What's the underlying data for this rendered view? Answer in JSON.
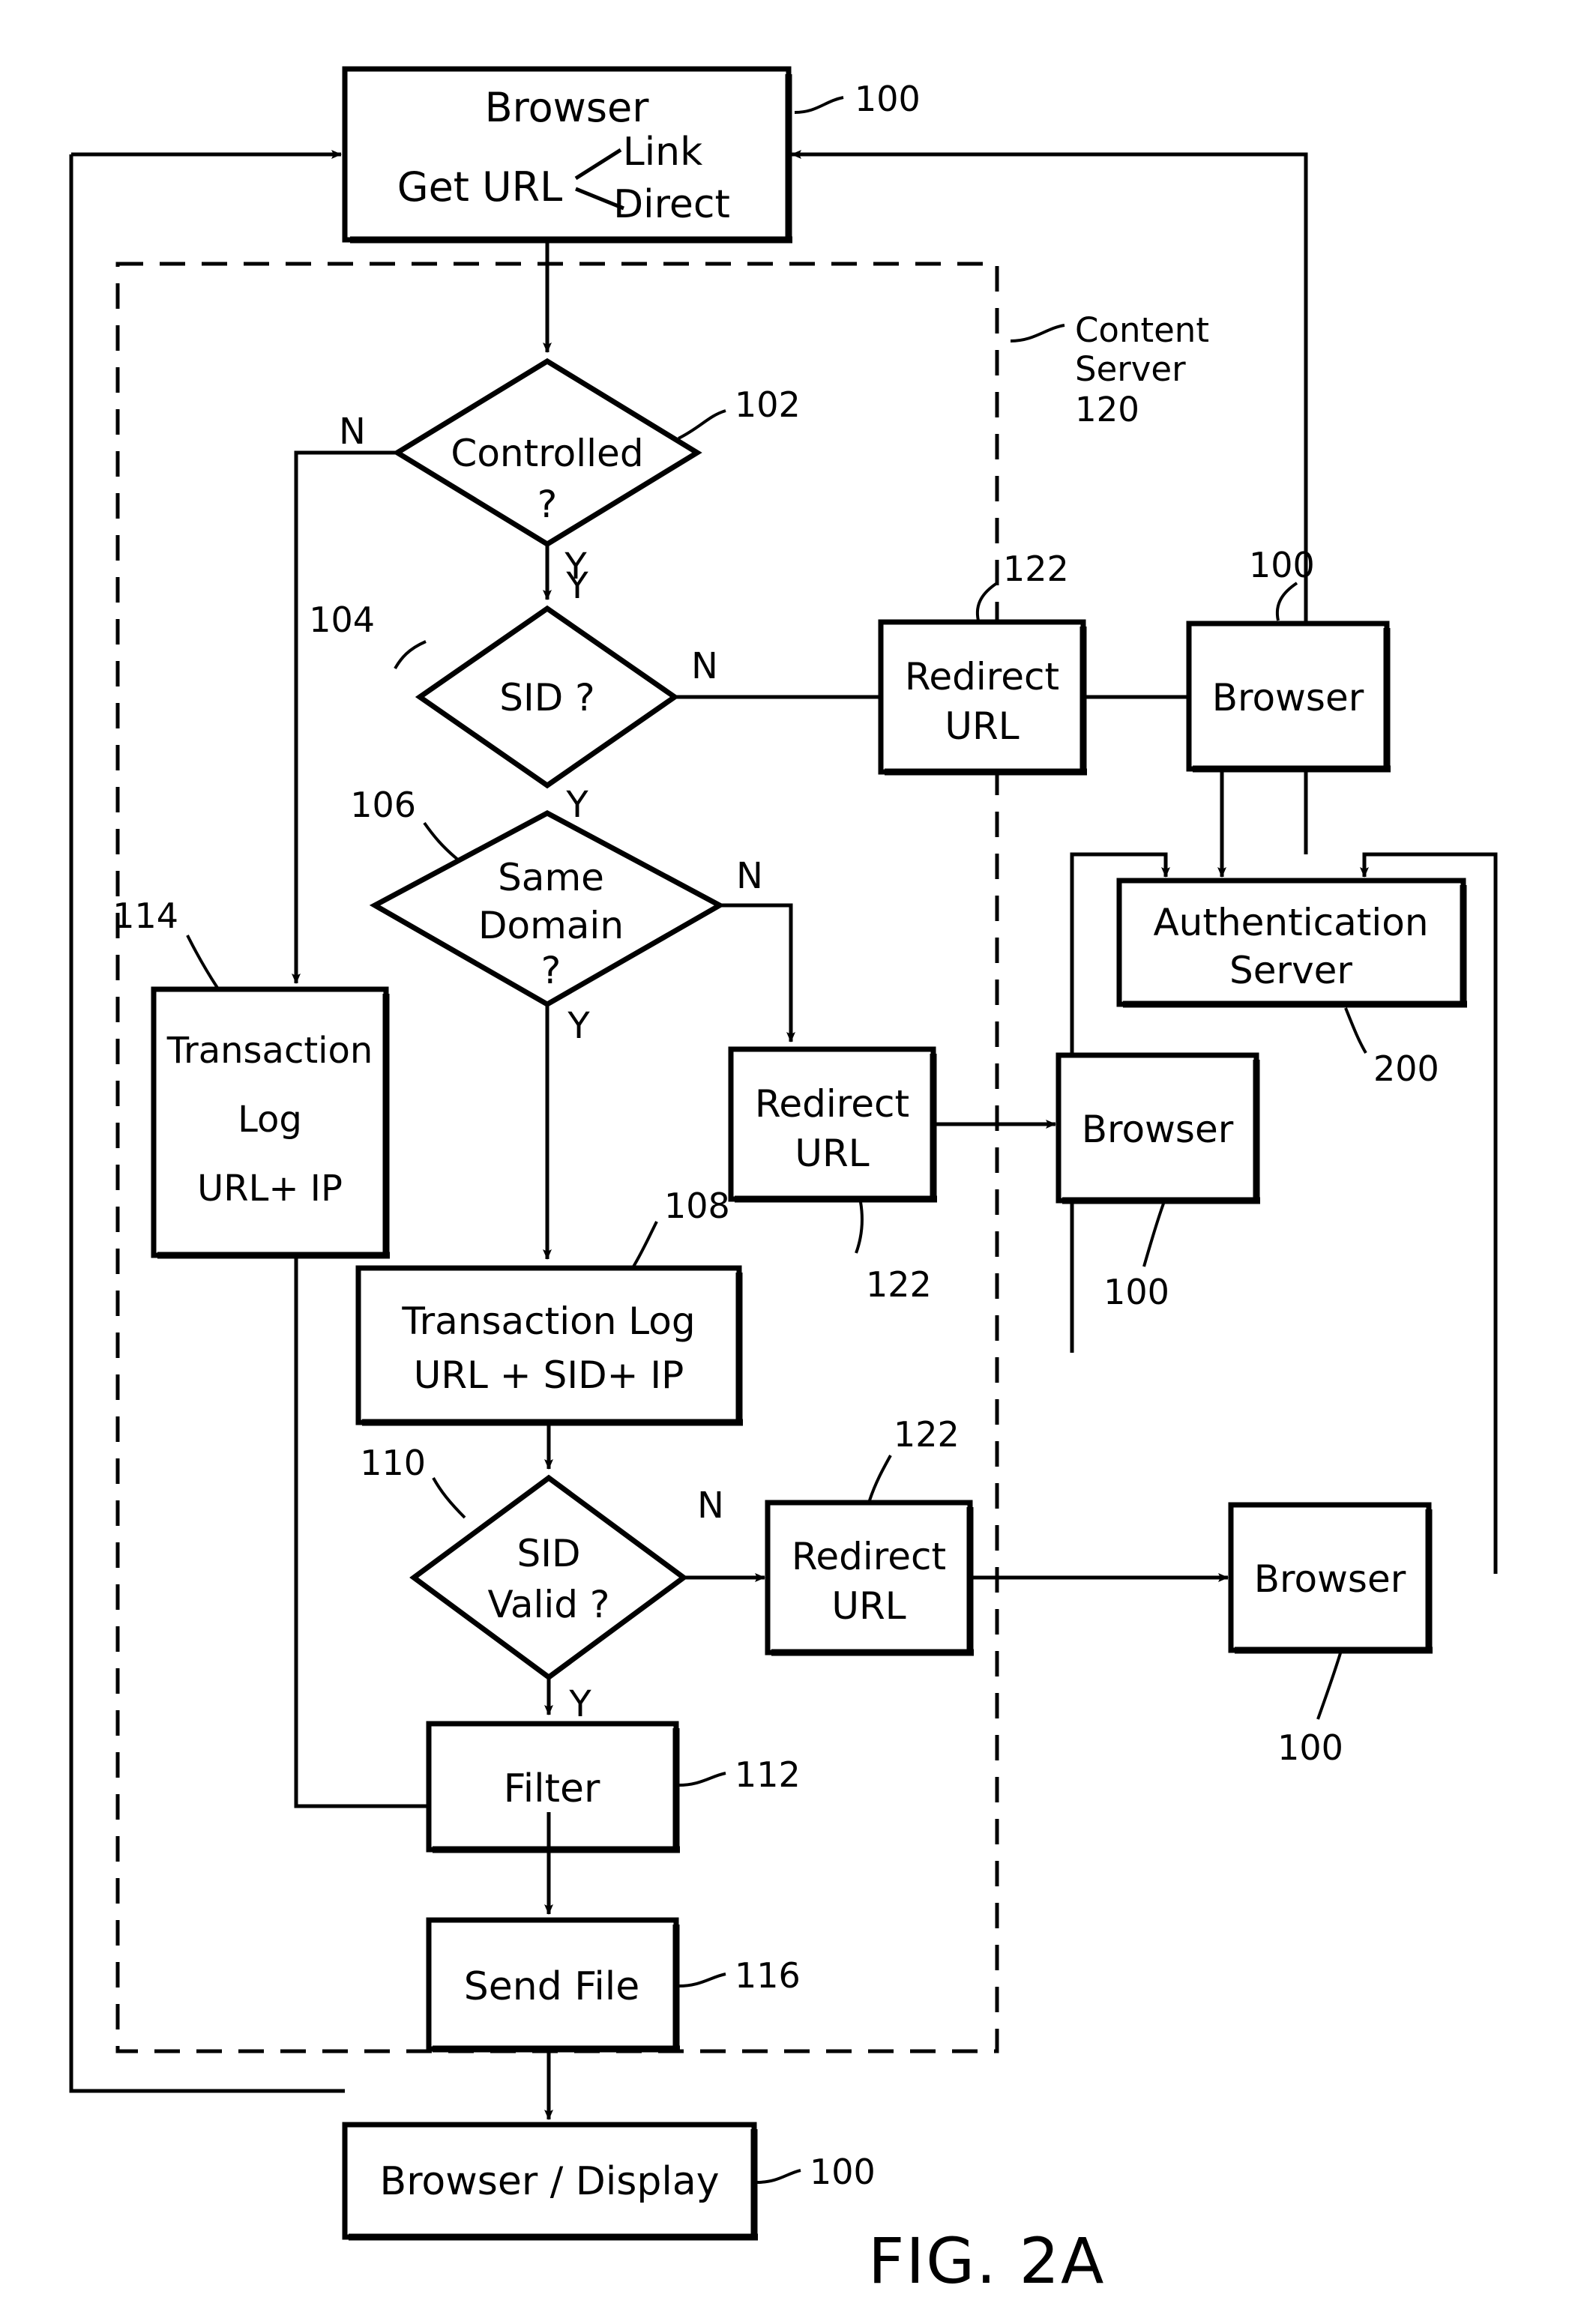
{
  "figure": {
    "caption": "FIG. 2A",
    "title": "Browser / Content Server / Authentication Server URL access control flow"
  },
  "boundary": {
    "label_line1": "Content",
    "label_line2": "Server",
    "ref": "120",
    "style": "dashed"
  },
  "colors": {
    "line": "#000000",
    "background": "#ffffff",
    "text": "#000000"
  },
  "nodes": [
    {
      "id": "browser_top",
      "shape": "box",
      "ref": "100",
      "lines": [
        "Browser",
        "Get URL",
        "Link",
        "Direct"
      ]
    },
    {
      "id": "controlled",
      "shape": "diamond",
      "ref": "102",
      "lines": [
        "Controlled",
        "?"
      ]
    },
    {
      "id": "sid",
      "shape": "diamond",
      "ref": "104",
      "lines": [
        "SID ?"
      ]
    },
    {
      "id": "redirect1",
      "shape": "box",
      "ref": "122",
      "lines": [
        "Redirect",
        "URL"
      ]
    },
    {
      "id": "browser1",
      "shape": "box",
      "ref": "100",
      "lines": [
        "Browser"
      ]
    },
    {
      "id": "same_domain",
      "shape": "diamond",
      "ref": "106",
      "lines": [
        "Same",
        "Domain",
        "?"
      ]
    },
    {
      "id": "auth_server",
      "shape": "box",
      "ref": "200",
      "lines": [
        "Authentication",
        "Server"
      ]
    },
    {
      "id": "tlog_urlip",
      "shape": "box",
      "ref": "114",
      "lines": [
        "Transaction",
        "Log",
        "URL+ IP"
      ]
    },
    {
      "id": "redirect2",
      "shape": "box",
      "ref": "122",
      "lines": [
        "Redirect",
        "URL"
      ]
    },
    {
      "id": "browser2",
      "shape": "box",
      "ref": "100",
      "lines": [
        "Browser"
      ]
    },
    {
      "id": "tlog_full",
      "shape": "box",
      "ref": "108",
      "lines": [
        "Transaction Log",
        "URL + SID+ IP"
      ]
    },
    {
      "id": "sid_valid",
      "shape": "diamond",
      "ref": "110",
      "lines": [
        "SID",
        "Valid ?"
      ]
    },
    {
      "id": "redirect3",
      "shape": "box",
      "ref": "122",
      "lines": [
        "Redirect",
        "URL"
      ]
    },
    {
      "id": "browser3",
      "shape": "box",
      "ref": "100",
      "lines": [
        "Browser"
      ]
    },
    {
      "id": "filter",
      "shape": "box",
      "ref": "112",
      "lines": [
        "Filter"
      ]
    },
    {
      "id": "send_file",
      "shape": "box",
      "ref": "116",
      "lines": [
        "Send File"
      ]
    },
    {
      "id": "browser_disp",
      "shape": "box",
      "ref": "100",
      "lines": [
        "Browser / Display"
      ]
    }
  ],
  "branch_labels": {
    "controlled_no": "N",
    "controlled_yes": "Y",
    "sid_no": "N",
    "sid_yes": "Y",
    "same_domain_no": "N",
    "same_domain_yes": "Y",
    "sid_valid_no": "N",
    "sid_valid_yes": "Y"
  },
  "text": {
    "browser_title": "Browser",
    "get_url": "Get URL",
    "link": "Link",
    "direct": "Direct",
    "controlled": "Controlled",
    "qmark": "?",
    "sid_q": "SID ?",
    "redirect": "Redirect",
    "url": "URL",
    "browser": "Browser",
    "same": "Same",
    "domain": "Domain",
    "auth": "Authentication",
    "server": "Server",
    "transaction": "Transaction",
    "log": "Log",
    "url_ip": "URL+ IP",
    "transaction_log": "Transaction Log",
    "url_sid_ip": "URL + SID+ IP",
    "sid": "SID",
    "valid_q": "Valid ?",
    "filter": "Filter",
    "send_file": "Send File",
    "browser_display": "Browser / Display",
    "content": "Content",
    "server2": "Server",
    "fig_caption": "FIG. 2A"
  },
  "refs": {
    "r100": "100",
    "r102": "102",
    "r104": "104",
    "r106": "106",
    "r108": "108",
    "r110": "110",
    "r112": "112",
    "r114": "114",
    "r116": "116",
    "r120": "120",
    "r122": "122",
    "r200": "200"
  }
}
